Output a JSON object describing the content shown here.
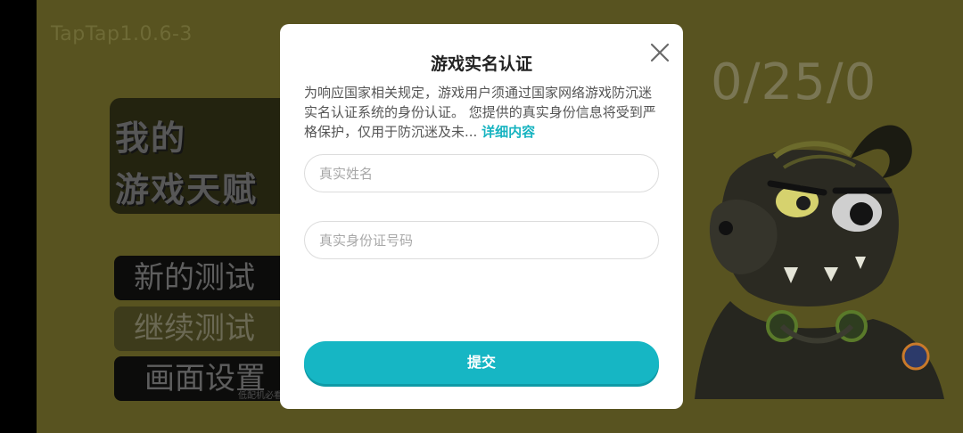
{
  "game": {
    "version_label": "TapTap1.0.6-3",
    "counter": "0/25/0",
    "title_line1": "我的",
    "title_line2": "游戏天赋",
    "menu": {
      "new_test": "新的测试",
      "continue_test": "继续测试",
      "display_settings": "画面设置",
      "low_end_note": "低配机必看"
    }
  },
  "dialog": {
    "title": "游戏实名认证",
    "notice_text": "为响应国家相关规定，游戏用户须通过国家网络游戏防沉迷实名认证系统的身份认证。 您提供的真实身份信息将受到严格保护，仅用于防沉迷及未...",
    "details_link": "详细内容",
    "name_placeholder": "真实姓名",
    "id_placeholder": "真实身份证号码",
    "submit_label": "提交",
    "accent_color": "#16b6c4"
  }
}
